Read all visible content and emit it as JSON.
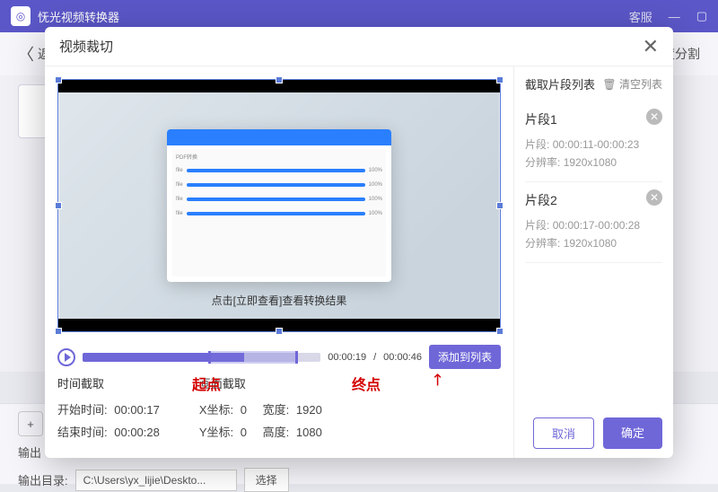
{
  "app": {
    "title": "怃光视频转换器",
    "customer": "客服"
  },
  "bg": {
    "back": "返",
    "split": "度分割",
    "output_label": "输出",
    "outdir_label": "输出目录:",
    "outdir_path": "C:\\Users\\yx_lijie\\Deskto...",
    "browse": "选择"
  },
  "modal": {
    "title": "视频裁切"
  },
  "preview": {
    "tip": "点击[立即查看]查看转换结果"
  },
  "timeline": {
    "current": "00:00:19",
    "total": "00:00:46",
    "add_label": "添加到列表"
  },
  "annot": {
    "start": "起点",
    "end": "终点"
  },
  "crop": {
    "time_header": "时间截取",
    "area_header": "画面截取",
    "start_label": "开始时间:",
    "start_val": "00:00:17",
    "end_label": "结束时间:",
    "end_val": "00:00:28",
    "x_label": "X坐标:",
    "x_val": "0",
    "w_label": "宽度:",
    "w_val": "1920",
    "y_label": "Y坐标:",
    "y_val": "0",
    "h_label": "高度:",
    "h_val": "1080"
  },
  "right": {
    "header": "截取片段列表",
    "clear": "清空列表",
    "seg_label": "片段:",
    "res_label": "分辨率:",
    "clips": [
      {
        "name": "片段1",
        "range": "00:00:11-00:00:23",
        "res": "1920x1080"
      },
      {
        "name": "片段2",
        "range": "00:00:17-00:00:28",
        "res": "1920x1080"
      }
    ]
  },
  "buttons": {
    "cancel": "取消",
    "ok": "确定"
  }
}
